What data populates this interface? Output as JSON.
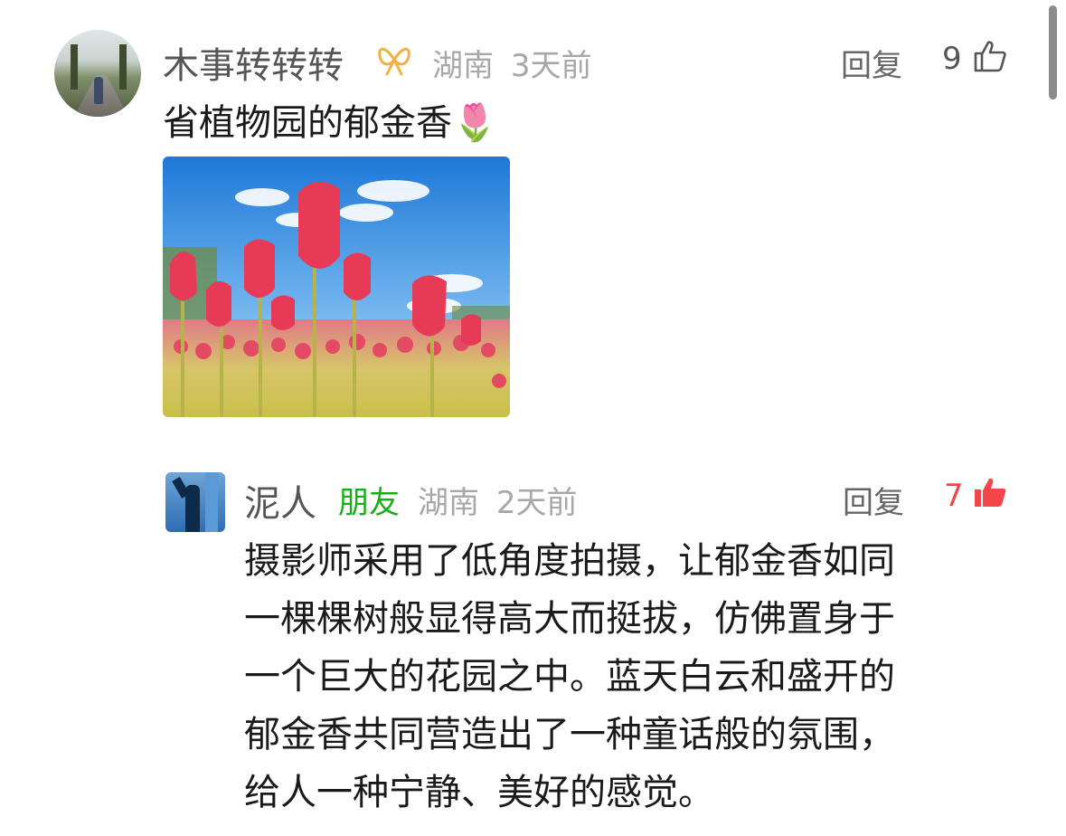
{
  "comment": {
    "username": "木事转转转",
    "badge_icon": "ribbon-icon",
    "location": "湖南",
    "time": "3天前",
    "reply_label": "回复",
    "like_count": "9",
    "text": "省植物园的郁金香🌷"
  },
  "reply": {
    "username": "泥人",
    "tag": "朋友",
    "location": "湖南",
    "time": "2天前",
    "reply_label": "回复",
    "like_count": "7",
    "like_color": "#f2474a",
    "text_lines": [
      "摄影师采用了低角度拍摄，让郁金香如同",
      "一棵棵树般显得高大而挺拔，仿佛置身于",
      "一个巨大的花园之中。蓝天白云和盛开的",
      "郁金香共同营造出了一种童话般的氛围，",
      "给人一种宁静、美好的感觉。"
    ]
  },
  "colors": {
    "friend_tag": "#1aad19",
    "ribbon": "#f5b041"
  }
}
